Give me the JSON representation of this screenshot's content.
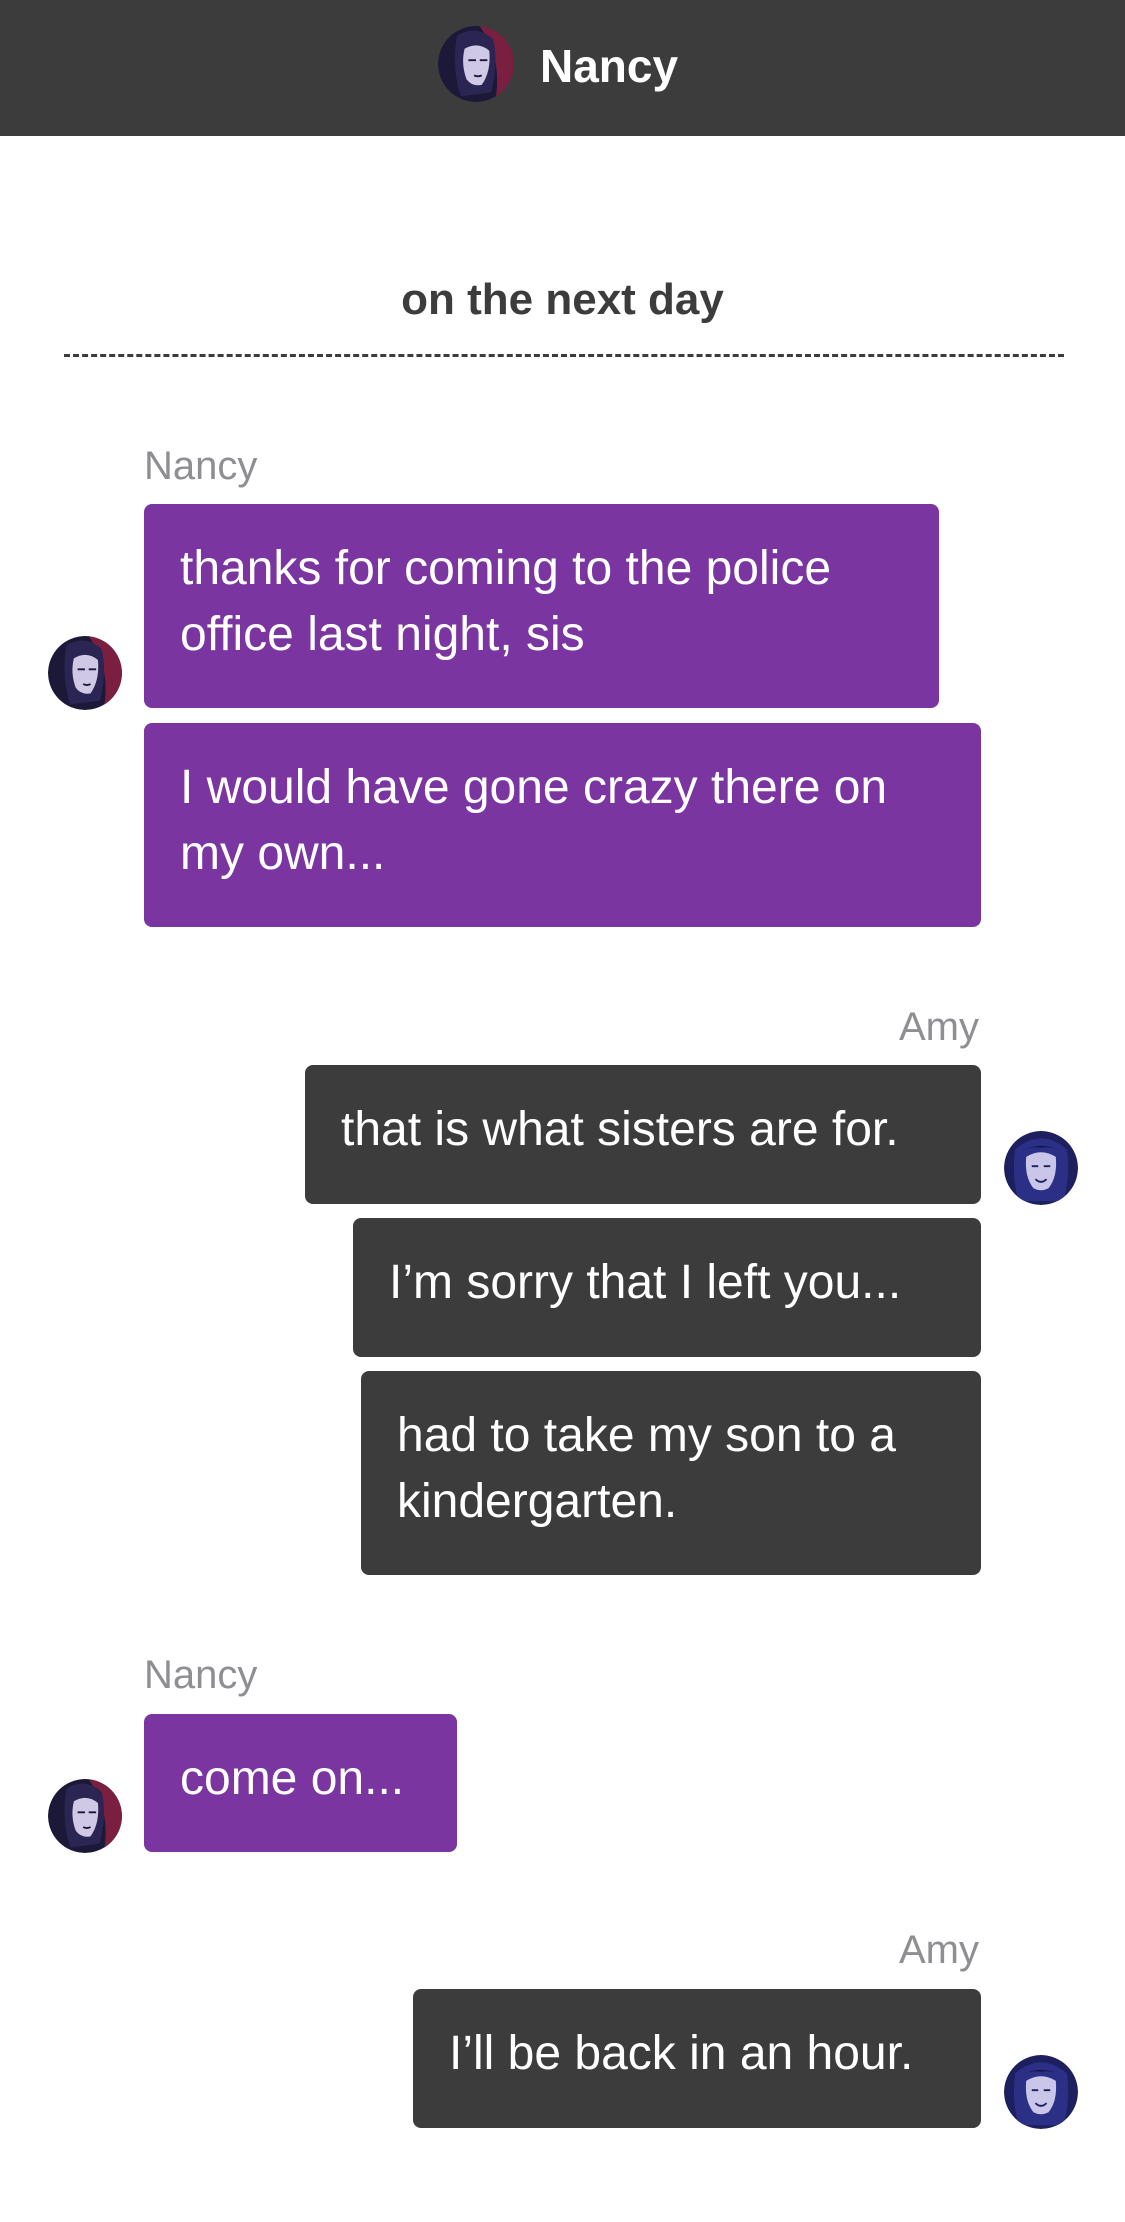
{
  "header": {
    "title": "Nancy"
  },
  "divider": {
    "label": "on the next day"
  },
  "messages": [
    {
      "sender": "Nancy",
      "bubbles": [
        "thanks for coming to the police office last night, sis",
        "I would have gone crazy there on my own..."
      ]
    },
    {
      "sender": "Amy",
      "bubbles": [
        "that is what sisters are for.",
        "I’m sorry that I left you...",
        "had to take my son to a kindergarten."
      ]
    },
    {
      "sender": "Nancy",
      "bubbles": [
        "come on..."
      ]
    },
    {
      "sender": "Amy",
      "bubbles": [
        "I’ll be back in an hour."
      ]
    }
  ],
  "colors": {
    "header_bg": "#3c3c3c",
    "nancy_bubble": "#7b35a0",
    "amy_bubble": "#3c3c3c",
    "sender_label": "#8e8e93"
  },
  "icons": {
    "nancy_avatar": "nancy-avatar-icon",
    "amy_avatar": "amy-avatar-icon"
  }
}
